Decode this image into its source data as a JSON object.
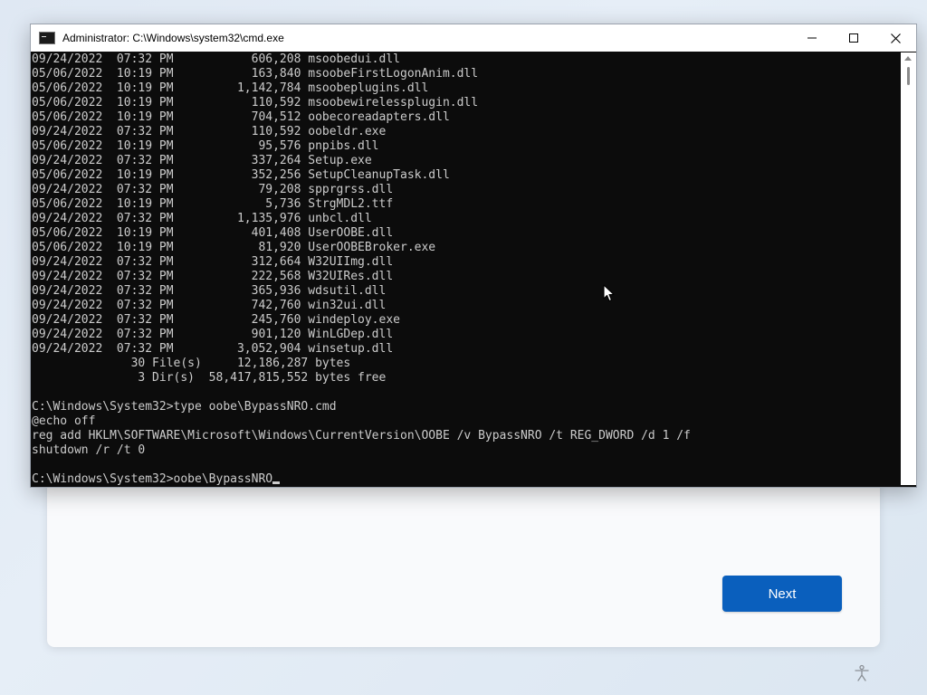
{
  "window": {
    "title": "Administrator: C:\\Windows\\system32\\cmd.exe"
  },
  "console": {
    "lines": [
      "09/24/2022  07:32 PM           606,208 msoobedui.dll",
      "05/06/2022  10:19 PM           163,840 msoobeFirstLogonAnim.dll",
      "05/06/2022  10:19 PM         1,142,784 msoobeplugins.dll",
      "05/06/2022  10:19 PM           110,592 msoobewirelessplugin.dll",
      "05/06/2022  10:19 PM           704,512 oobecoreadapters.dll",
      "09/24/2022  07:32 PM           110,592 oobeldr.exe",
      "05/06/2022  10:19 PM            95,576 pnpibs.dll",
      "09/24/2022  07:32 PM           337,264 Setup.exe",
      "05/06/2022  10:19 PM           352,256 SetupCleanupTask.dll",
      "09/24/2022  07:32 PM            79,208 spprgrss.dll",
      "05/06/2022  10:19 PM             5,736 StrgMDL2.ttf",
      "09/24/2022  07:32 PM         1,135,976 unbcl.dll",
      "05/06/2022  10:19 PM           401,408 UserOOBE.dll",
      "05/06/2022  10:19 PM            81,920 UserOOBEBroker.exe",
      "09/24/2022  07:32 PM           312,664 W32UIImg.dll",
      "09/24/2022  07:32 PM           222,568 W32UIRes.dll",
      "09/24/2022  07:32 PM           365,936 wdsutil.dll",
      "09/24/2022  07:32 PM           742,760 win32ui.dll",
      "09/24/2022  07:32 PM           245,760 windeploy.exe",
      "09/24/2022  07:32 PM           901,120 WinLGDep.dll",
      "09/24/2022  07:32 PM         3,052,904 winsetup.dll",
      "              30 File(s)     12,186,287 bytes",
      "               3 Dir(s)  58,417,815,552 bytes free",
      "",
      "C:\\Windows\\System32>type oobe\\BypassNRO.cmd",
      "@echo off",
      "reg add HKLM\\SOFTWARE\\Microsoft\\Windows\\CurrentVersion\\OOBE /v BypassNRO /t REG_DWORD /d 1 /f",
      "shutdown /r /t 0",
      ""
    ],
    "prompt": "C:\\Windows\\System32>oobe\\BypassNRO"
  },
  "oobe": {
    "next_label": "Next"
  },
  "colors": {
    "accent": "#0a5fbd",
    "console_bg": "#0c0c0c",
    "console_fg": "#cccccc"
  },
  "icons": {
    "app": "console-icon",
    "minimize": "minimize-icon",
    "maximize": "maximize-icon",
    "close": "close-icon",
    "accessibility": "accessibility-icon",
    "pointer": "mouse-pointer-icon"
  }
}
